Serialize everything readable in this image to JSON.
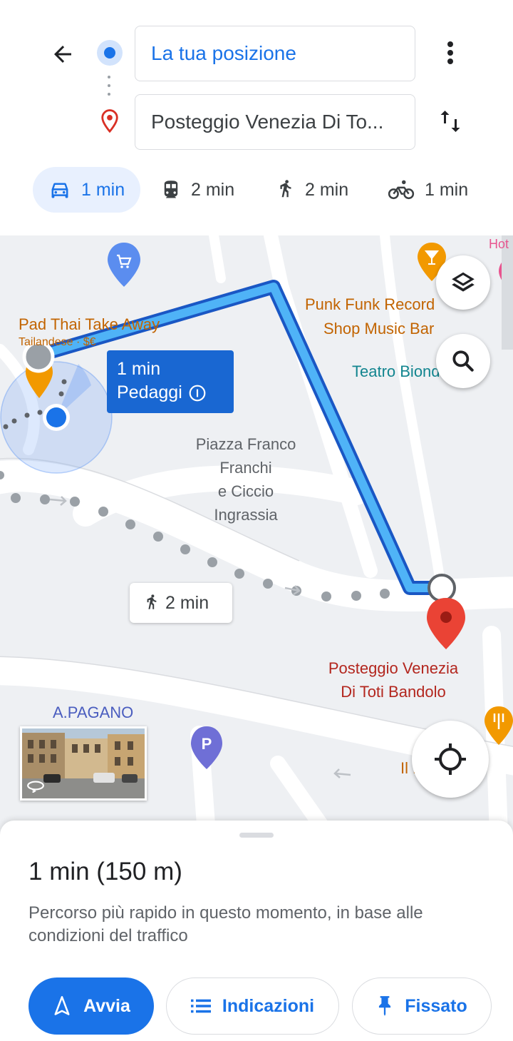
{
  "search": {
    "origin_value": "La tua posizione",
    "destination_value": "Posteggio Venezia Di To..."
  },
  "modes": [
    {
      "name": "car",
      "time": "1 min",
      "active": true
    },
    {
      "name": "transit",
      "time": "2 min"
    },
    {
      "name": "walk",
      "time": "2 min"
    },
    {
      "name": "bike",
      "time": "1 min"
    }
  ],
  "map": {
    "labels": {
      "pad_thai": "Pad Thai Take Away",
      "pad_thai_sub": "Tailandese · $€",
      "punk_funk_1": "Punk Funk Record",
      "punk_funk_2": "Shop Music Bar",
      "teatro": "Teatro Biondo Stab",
      "piazza_1": "Piazza Franco",
      "piazza_2": "Franchi",
      "piazza_3": "e Ciccio",
      "piazza_4": "Ingrassia",
      "dest_1": "Posteggio Venezia",
      "dest_2": "Di Toti Bandolo",
      "apagano": "A.PAGANO",
      "il_bosso": "Il Bosso",
      "hotel": "Hot"
    },
    "route_callout": {
      "time": "1 min",
      "tolls": "Pedaggi"
    },
    "walk_chip": "2 min"
  },
  "sheet": {
    "summary": "1 min (150 m)",
    "description": "Percorso più rapido in questo momento, in base alle condizioni del traffico",
    "start_label": "Avvia",
    "steps_label": "Indicazioni",
    "pin_label": "Fissato"
  },
  "colors": {
    "accent": "#1a73e8",
    "route": "#4285f4",
    "dest_pin": "#ea4335"
  }
}
